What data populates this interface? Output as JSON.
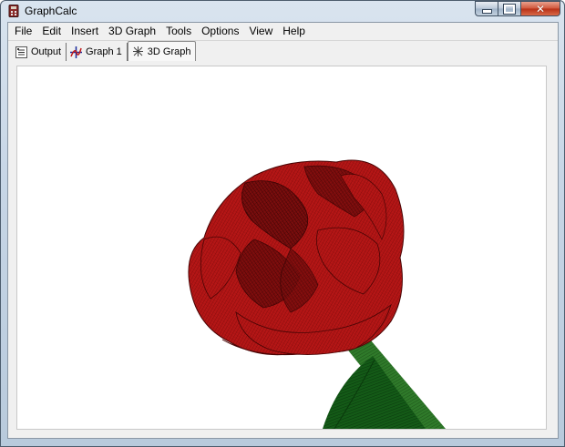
{
  "window": {
    "title": "GraphCalc"
  },
  "menubar": {
    "items": [
      "File",
      "Edit",
      "Insert",
      "3D Graph",
      "Tools",
      "Options",
      "View",
      "Help"
    ]
  },
  "tabs": [
    {
      "label": "Output",
      "icon": "output-icon",
      "active": false
    },
    {
      "label": "Graph 1",
      "icon": "graph-2d-icon",
      "active": false
    },
    {
      "label": "3D Graph",
      "icon": "graph-3d-icon",
      "active": true
    }
  ],
  "colors": {
    "petal": "#b01414",
    "petal_dark": "#5a0606",
    "stem": "#2f7a2a",
    "leaf": "#0f4a12"
  }
}
